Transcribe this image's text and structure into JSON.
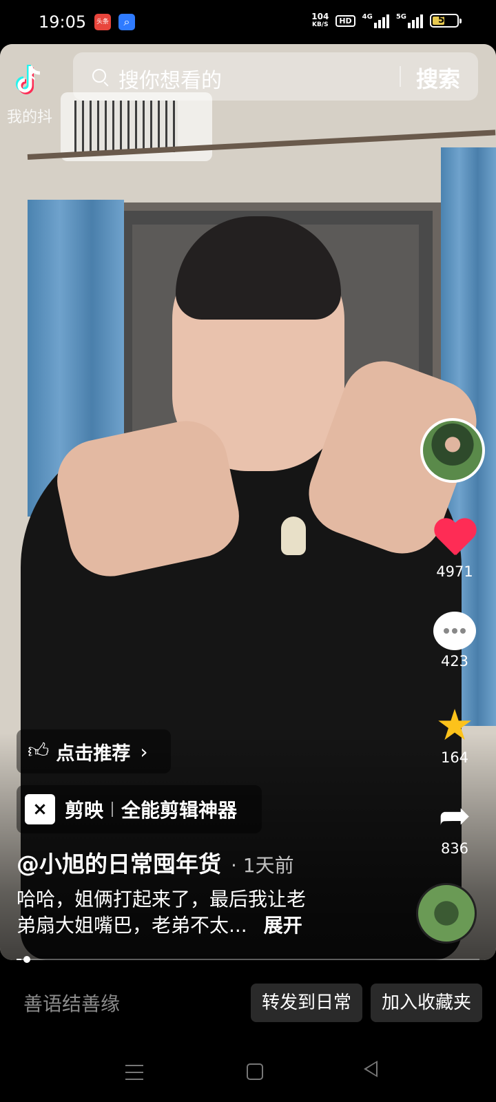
{
  "status_bar": {
    "time": "19:05",
    "app_badge_toutiao": "头条",
    "net_speed_value": "104",
    "net_speed_unit": "KB/S",
    "hd_badge": "HD",
    "signal_1_label": "4G",
    "signal_2_label": "5G",
    "battery_level": "50",
    "battery_fraction": 0.5
  },
  "header": {
    "back_icon": "chevron-left-icon",
    "my_tiktok_label": "我的抖",
    "search_placeholder": "搜你想看的",
    "search_button": "搜索"
  },
  "rail": {
    "likes": "4971",
    "comments": "423",
    "favorites": "164",
    "shares": "836",
    "colors": {
      "like": "#fe2c55",
      "favorite": "#fcc21b"
    }
  },
  "overlay": {
    "recommend_label": "点击推荐",
    "capcut_name": "剪映",
    "capcut_slogan": "全能剪辑神器",
    "author": "@小旭的日常囤年货",
    "post_time": "· 1天前",
    "caption_line1": "哈哈，姐俩打起来了，最后我让老",
    "caption_line2": "弟扇大姐嘴巴，老弟不太...",
    "expand_label": "展开",
    "progress_fraction": 0.01
  },
  "bottom_bar": {
    "comment_placeholder": "善语结善缘",
    "repost_button": "转发到日常",
    "favorite_button": "加入收藏夹"
  }
}
